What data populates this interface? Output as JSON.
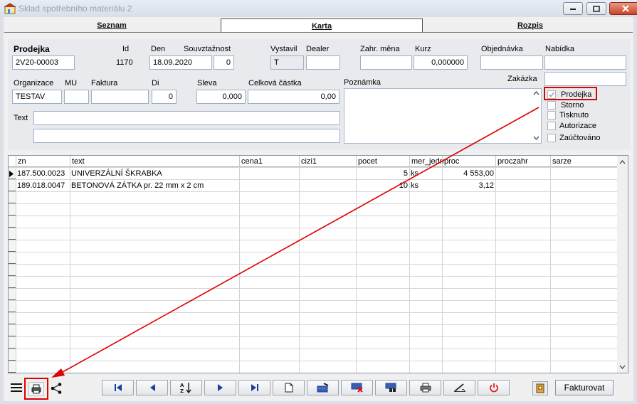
{
  "window": {
    "title": "Sklad spotřebního materiálu 2",
    "icons": [
      "minimize-icon",
      "maximize-icon",
      "close-icon"
    ]
  },
  "tabs": [
    {
      "label": "Seznam",
      "active": false
    },
    {
      "label": "Karta",
      "active": true
    },
    {
      "label": "Rozpis",
      "active": false
    }
  ],
  "form": {
    "doc_type": "Prodejka",
    "doc_number": "2V20-00003",
    "id_label": "Id",
    "id_value": "1170",
    "den_label": "Den",
    "den_value": "18.09.2020",
    "souvztaznost_label": "Souvztažnost",
    "souvztaznost_value": "0",
    "vystavil_label": "Vystavil",
    "vystavil_value": "T",
    "dealer_label": "Dealer",
    "dealer_value": "",
    "zahr_mena_label": "Zahr. měna",
    "zahr_mena_value": "",
    "kurz_label": "Kurz",
    "kurz_value": "0,000000",
    "objednavka_label": "Objednávka",
    "objednavka_value": "",
    "nabidka_label": "Nabídka",
    "nabidka_value": "",
    "zakazka_label": "Zakázka",
    "zakazka_value": "",
    "organizace_label": "Organizace",
    "organizace_value": "TESTAV",
    "mu_label": "MU",
    "mu_value": "",
    "faktura_label": "Faktura",
    "faktura_value": "",
    "di_label": "Di",
    "di_value": "0",
    "sleva_label": "Sleva",
    "sleva_value": "0,000",
    "celkova_label": "Celková částka",
    "celkova_value": "0,00",
    "poznamka_label": "Poznámka",
    "text_label": "Text",
    "text_value_1": "",
    "text_value_2": ""
  },
  "checkboxes": [
    {
      "label": "Prodejka",
      "checked": true,
      "disabled": true
    },
    {
      "label": "Storno",
      "checked": false
    },
    {
      "label": "Tisknuto",
      "checked": false
    },
    {
      "label": "Autorizace",
      "checked": false
    },
    {
      "label": "Zaúčtováno",
      "checked": false
    }
  ],
  "table": {
    "columns": [
      "zn",
      "text",
      "cena1",
      "cizi1",
      "pocet",
      "mer_jedn",
      "proc",
      "proczahr",
      "sarze"
    ],
    "rows": [
      {
        "zn": "187.500.0023",
        "text": "UNIVERZÁLNÍ ŠKRABKA",
        "cena1": "",
        "cizi1": "",
        "pocet": "5",
        "mer_jedn": "ks",
        "proc": "4 553,00",
        "proczahr": "",
        "sarze": ""
      },
      {
        "zn": "189.018.0047",
        "text": "BETONOVÁ ZÁTKA pr. 22 mm x 2 cm",
        "cena1": "",
        "cizi1": "",
        "pocet": "10",
        "mer_jedn": "ks",
        "proc": "3,12",
        "proczahr": "",
        "sarze": ""
      }
    ]
  },
  "toolbar": {
    "left_icons": [
      "menu-icon",
      "print-preview-icon",
      "tree-icon"
    ],
    "nav_icons": [
      "first-record-icon",
      "previous-record-icon",
      "sort-az-icon",
      "next-record-icon",
      "last-record-icon",
      "new-document-icon",
      "edit-keyboard-icon",
      "delete-keyboard-icon",
      "search-keyboard-icon",
      "printer-icon",
      "sign-icon",
      "power-icon"
    ],
    "book_icon": "book-icon",
    "fakturovat_label": "Fakturovat"
  },
  "colors": {
    "annotation_red": "#e00000",
    "power_red": "#e02020",
    "nav_blue": "#1c3f9e"
  }
}
